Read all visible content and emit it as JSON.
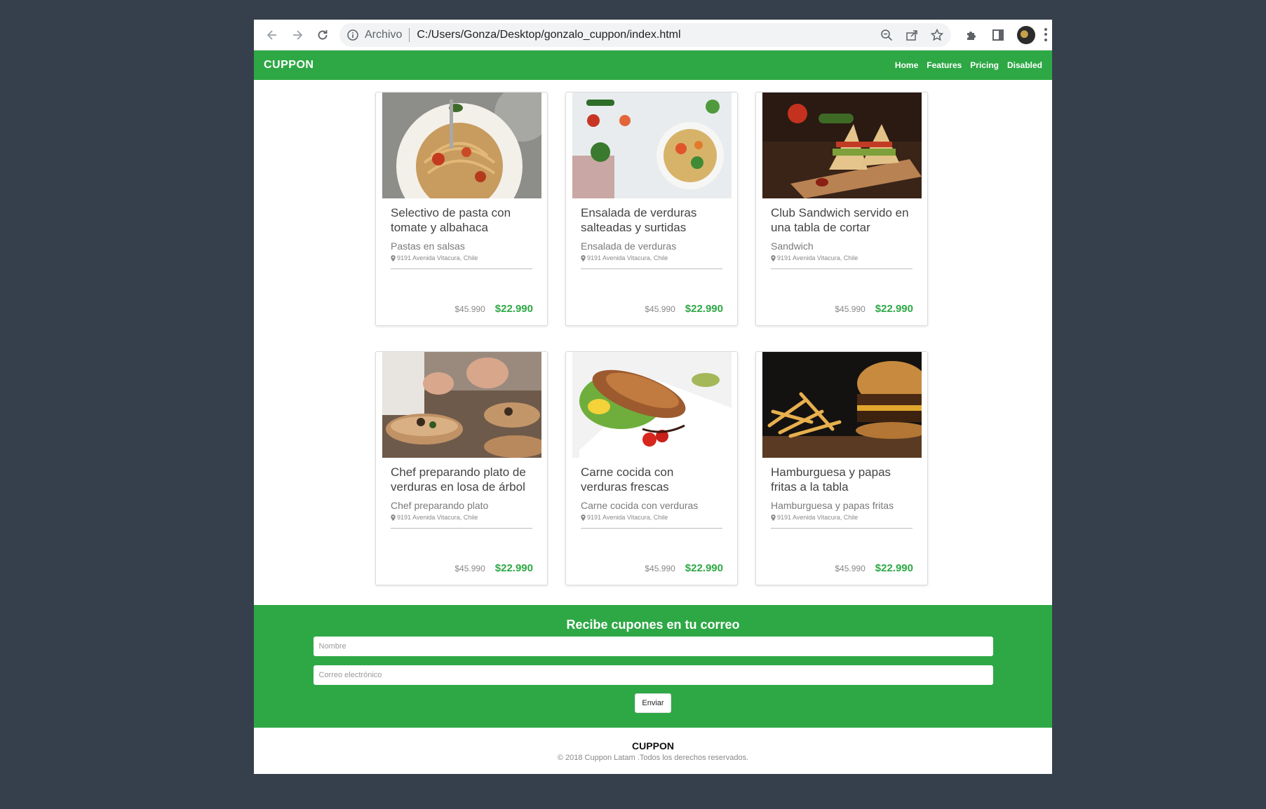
{
  "browser": {
    "scheme_label": "Archivo",
    "url": "C:/Users/Gonza/Desktop/gonzalo_cuppon/index.html"
  },
  "site": {
    "brand": "CUPPON",
    "nav": [
      "Home",
      "Features",
      "Pricing",
      "Disabled"
    ]
  },
  "cards": [
    {
      "title": "Selectivo de pasta con tomate y albahaca",
      "subtitle": "Pastas en salsas",
      "address": "9191 Avenida Vitacura, Chile",
      "old_price": "$45.990",
      "new_price": "$22.990",
      "image_icon": "pasta-photo"
    },
    {
      "title": "Ensalada de verduras salteadas y surtidas",
      "subtitle": "Ensalada de verduras",
      "address": "9191 Avenida Vitacura, Chile",
      "old_price": "$45.990",
      "new_price": "$22.990",
      "image_icon": "salad-photo"
    },
    {
      "title": "Club Sandwich servido en una tabla de cortar",
      "subtitle": "Sandwich",
      "address": "9191 Avenida Vitacura, Chile",
      "old_price": "$45.990",
      "new_price": "$22.990",
      "image_icon": "sandwich-photo"
    },
    {
      "title": "Chef preparando plato de verduras en losa de árbol",
      "subtitle": "Chef preparando plato",
      "address": "9191 Avenida Vitacura, Chile",
      "old_price": "$45.990",
      "new_price": "$22.990",
      "image_icon": "chef-photo"
    },
    {
      "title": "Carne cocida con verduras frescas",
      "subtitle": "Carne cocida con verduras",
      "address": "9191 Avenida Vitacura, Chile",
      "old_price": "$45.990",
      "new_price": "$22.990",
      "image_icon": "meat-photo"
    },
    {
      "title": "Hamburguesa y papas fritas a la tabla",
      "subtitle": "Hamburguesa y papas fritas",
      "address": "9191 Avenida Vitacura, Chile",
      "old_price": "$45.990",
      "new_price": "$22.990",
      "image_icon": "burger-photo"
    }
  ],
  "newsletter": {
    "title": "Recibe cupones en tu correo",
    "name_placeholder": "Nombre",
    "email_placeholder": "Correo electrónico",
    "submit_label": "Enviar"
  },
  "footer": {
    "brand": "CUPPON",
    "copyright": "© 2018 Cuppon Latam .Todos los derechos reservados."
  },
  "colors": {
    "accent": "#2ea845",
    "desktop_bg": "#36404c"
  }
}
